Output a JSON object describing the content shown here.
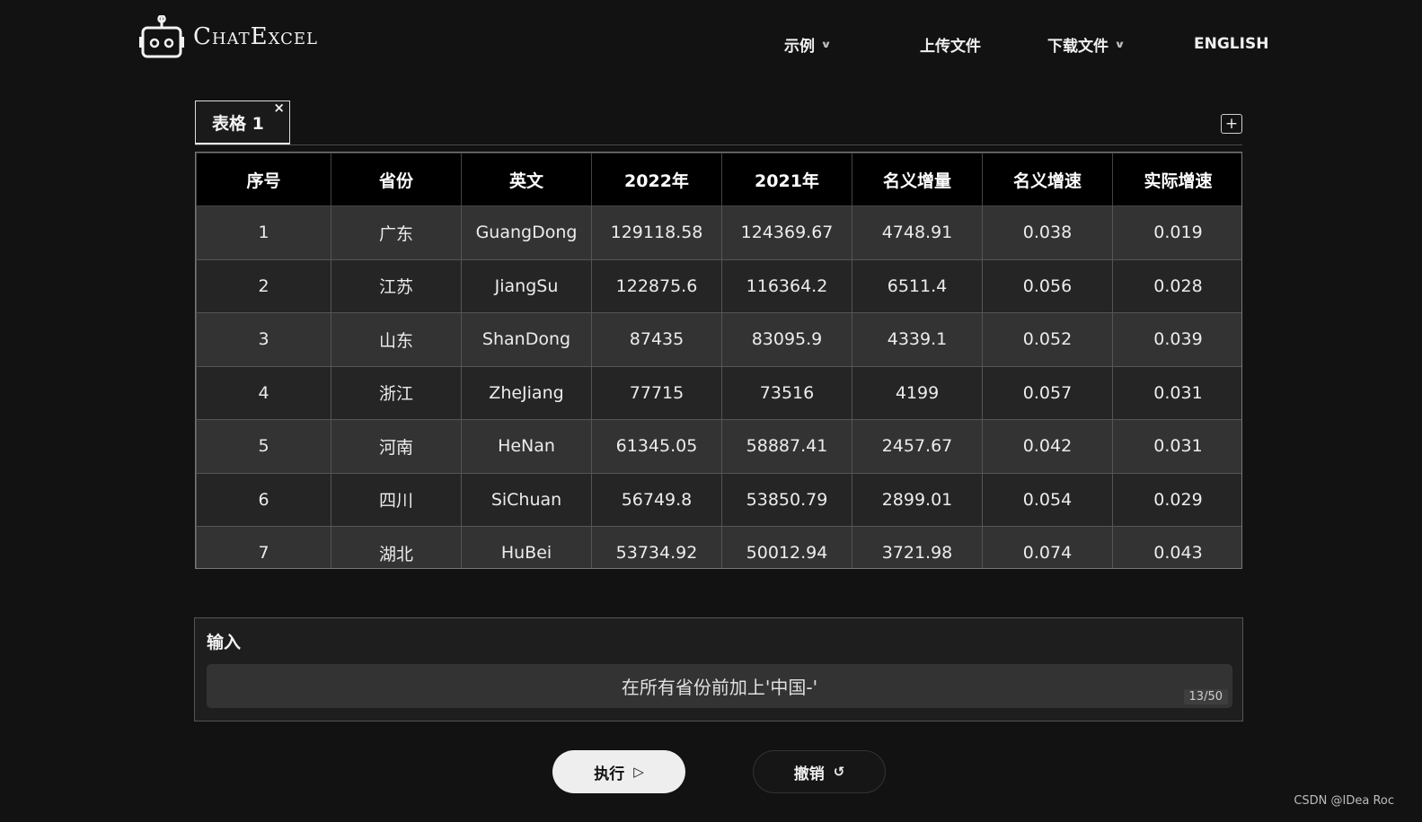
{
  "app": {
    "name": "ChatExcel"
  },
  "nav": {
    "examples": "示例",
    "upload": "上传文件",
    "download": "下载文件",
    "language": "ENGLISH"
  },
  "tabs": [
    {
      "label": "表格 1",
      "close": "×"
    }
  ],
  "add_tab": "+",
  "table": {
    "headers": [
      "序号",
      "省份",
      "英文",
      "2022年",
      "2021年",
      "名义增量",
      "名义增速",
      "实际增速"
    ],
    "rows": [
      [
        "1",
        "广东",
        "GuangDong",
        "129118.58",
        "124369.67",
        "4748.91",
        "0.038",
        "0.019"
      ],
      [
        "2",
        "江苏",
        "JiangSu",
        "122875.6",
        "116364.2",
        "6511.4",
        "0.056",
        "0.028"
      ],
      [
        "3",
        "山东",
        "ShanDong",
        "87435",
        "83095.9",
        "4339.1",
        "0.052",
        "0.039"
      ],
      [
        "4",
        "浙江",
        "ZheJiang",
        "77715",
        "73516",
        "4199",
        "0.057",
        "0.031"
      ],
      [
        "5",
        "河南",
        "HeNan",
        "61345.05",
        "58887.41",
        "2457.67",
        "0.042",
        "0.031"
      ],
      [
        "6",
        "四川",
        "SiChuan",
        "56749.8",
        "53850.79",
        "2899.01",
        "0.054",
        "0.029"
      ],
      [
        "7",
        "湖北",
        "HuBei",
        "53734.92",
        "50012.94",
        "3721.98",
        "0.074",
        "0.043"
      ]
    ]
  },
  "input": {
    "label": "输入",
    "value": "在所有省份前加上'中国-'",
    "counter": "13/50"
  },
  "buttons": {
    "run": "执行",
    "run_icon": "▷",
    "undo": "撤销",
    "undo_icon": "↺"
  },
  "watermark": "CSDN @IDea Roc",
  "icons": {
    "logo": "robot-icon",
    "chevron": "chevron-down-icon"
  }
}
